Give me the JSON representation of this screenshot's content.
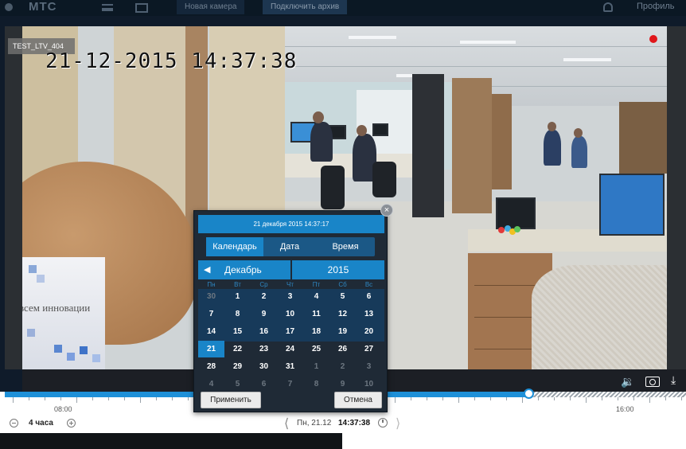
{
  "topbar": {
    "logo": "МТС",
    "tab_new_camera": "Новая камера",
    "tab_connect": "Подключить архив",
    "profile": "Профиль"
  },
  "video": {
    "camera_label": "TEST_LTV_404",
    "osd_timestamp": "21-12-2015 14:37:38",
    "bag_text": "всем инновации",
    "recording_color": "#e0161a"
  },
  "timeline": {
    "label_left": "08:00",
    "label_right": "16:00",
    "scale": "4 часа",
    "date": "Пн, 21.12",
    "time": "14:37:38",
    "accent_color": "#1e90d8"
  },
  "picker": {
    "header": "21 декабря 2015 14:37:17",
    "tabs": [
      "Календарь",
      "Дата",
      "Время"
    ],
    "active_tab": 0,
    "month": "Декабрь",
    "year": "2015",
    "weekdays": [
      "Пн",
      "Вт",
      "Ср",
      "Чт",
      "Пт",
      "Сб",
      "Вс"
    ],
    "weeks": [
      [
        "30",
        "1",
        "2",
        "3",
        "4",
        "5",
        "6"
      ],
      [
        "7",
        "8",
        "9",
        "10",
        "11",
        "12",
        "13"
      ],
      [
        "14",
        "15",
        "16",
        "17",
        "18",
        "19",
        "20"
      ],
      [
        "21",
        "22",
        "23",
        "24",
        "25",
        "26",
        "27"
      ],
      [
        "28",
        "29",
        "30",
        "31",
        "1",
        "2",
        "3"
      ],
      [
        "4",
        "5",
        "6",
        "7",
        "8",
        "9",
        "10"
      ]
    ],
    "selected_day": "21",
    "apply_label": "Применить",
    "cancel_label": "Отмена"
  }
}
